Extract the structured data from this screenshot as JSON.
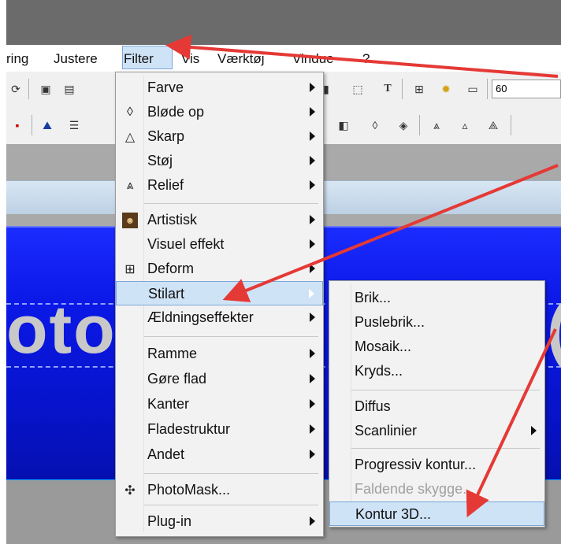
{
  "menubar": {
    "items": [
      {
        "label": "ring"
      },
      {
        "label": "Justere"
      },
      {
        "label": "Filter"
      },
      {
        "label": "Vis"
      },
      {
        "label": "Værktøj"
      },
      {
        "label": "Vindue"
      },
      {
        "label": "?"
      }
    ]
  },
  "toolbar": {
    "zoom_partial": "60"
  },
  "banner": {
    "text_left": "oto",
    "text_right": "("
  },
  "filter_menu": {
    "items": [
      {
        "label": "Farve",
        "icon": "none"
      },
      {
        "label": "Bløde op",
        "icon": "droplet-outline-icon"
      },
      {
        "label": "Skarp",
        "icon": "triangle-outline-icon"
      },
      {
        "label": "Støj",
        "icon": "none"
      },
      {
        "label": "Relief",
        "icon": "relief-icon"
      },
      {
        "label": "Artistisk",
        "icon": "mona-lisa-icon"
      },
      {
        "label": "Visuel effekt",
        "icon": "none"
      },
      {
        "label": "Deform",
        "icon": "grid-deform-icon"
      },
      {
        "label": "Stilart",
        "icon": "none"
      },
      {
        "label": "Ældningseffekter",
        "icon": "none"
      },
      {
        "label": "Ramme",
        "icon": "none"
      },
      {
        "label": "Gøre flad",
        "icon": "none"
      },
      {
        "label": "Kanter",
        "icon": "none"
      },
      {
        "label": "Fladestruktur",
        "icon": "none"
      },
      {
        "label": "Andet",
        "icon": "none"
      },
      {
        "label": "PhotoMask...",
        "icon": "photomask-icon"
      },
      {
        "label": "Plug-in",
        "icon": "none"
      }
    ]
  },
  "stilart_submenu": {
    "items": [
      {
        "label": "Brik..."
      },
      {
        "label": "Puslebrik..."
      },
      {
        "label": "Mosaik..."
      },
      {
        "label": "Kryds..."
      },
      {
        "label": "Diffus"
      },
      {
        "label": "Scanlinier"
      },
      {
        "label": "Progressiv kontur..."
      },
      {
        "label": "Faldende skygge..."
      },
      {
        "label": "Kontur 3D..."
      }
    ]
  },
  "colors": {
    "annotation_arrow": "#e53935",
    "highlight": "#cfe3f7",
    "banner_blue": "#0b18e6"
  }
}
